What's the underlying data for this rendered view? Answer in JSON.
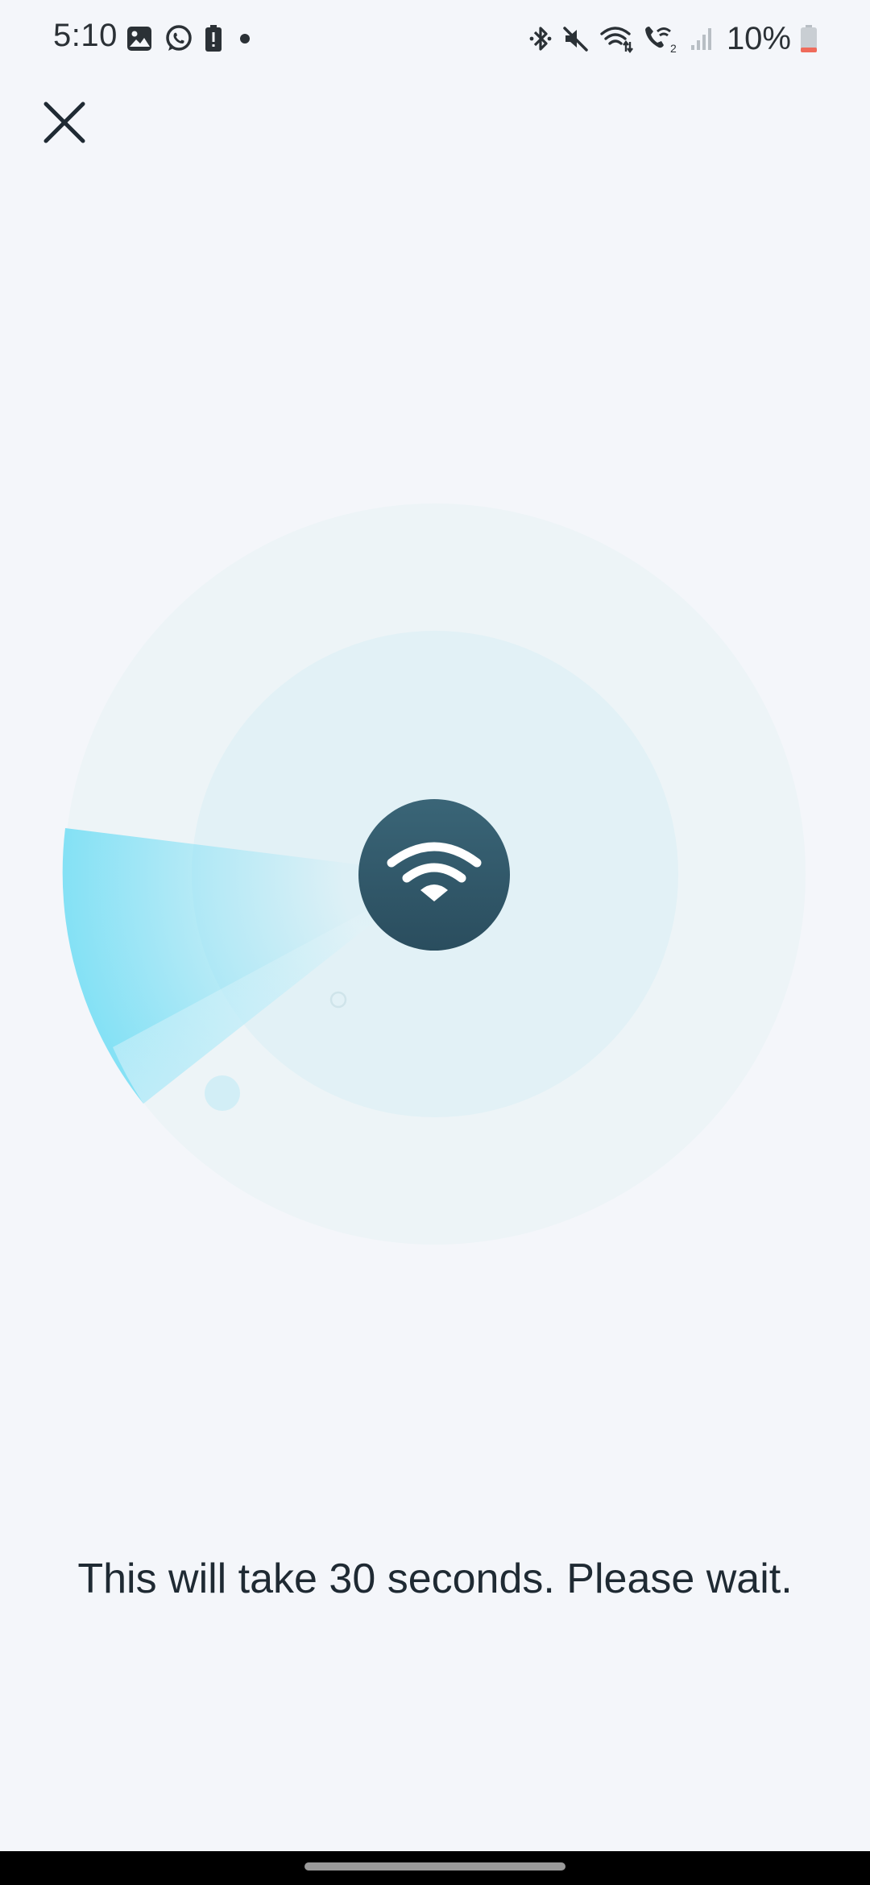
{
  "status_bar": {
    "time": "5:10",
    "left_icons": [
      "gallery-icon",
      "whatsapp-icon",
      "battery-alert-icon",
      "notification-dot-icon"
    ],
    "right_icons": [
      "bluetooth-icon",
      "mute-icon",
      "wifi-icon",
      "wifi-calling-icon",
      "signal-icon"
    ],
    "battery_percent": "10%"
  },
  "close_button": {
    "icon": "close-icon"
  },
  "radar": {
    "center_icon": "wifi-icon",
    "colors": {
      "outer_ring": "#edf4f7",
      "inner_ring": "#e2f1f6",
      "sweep": "#7fe0f5",
      "center": "#2f5869"
    }
  },
  "message": {
    "text": "This will take 30 seconds. Please wait."
  }
}
